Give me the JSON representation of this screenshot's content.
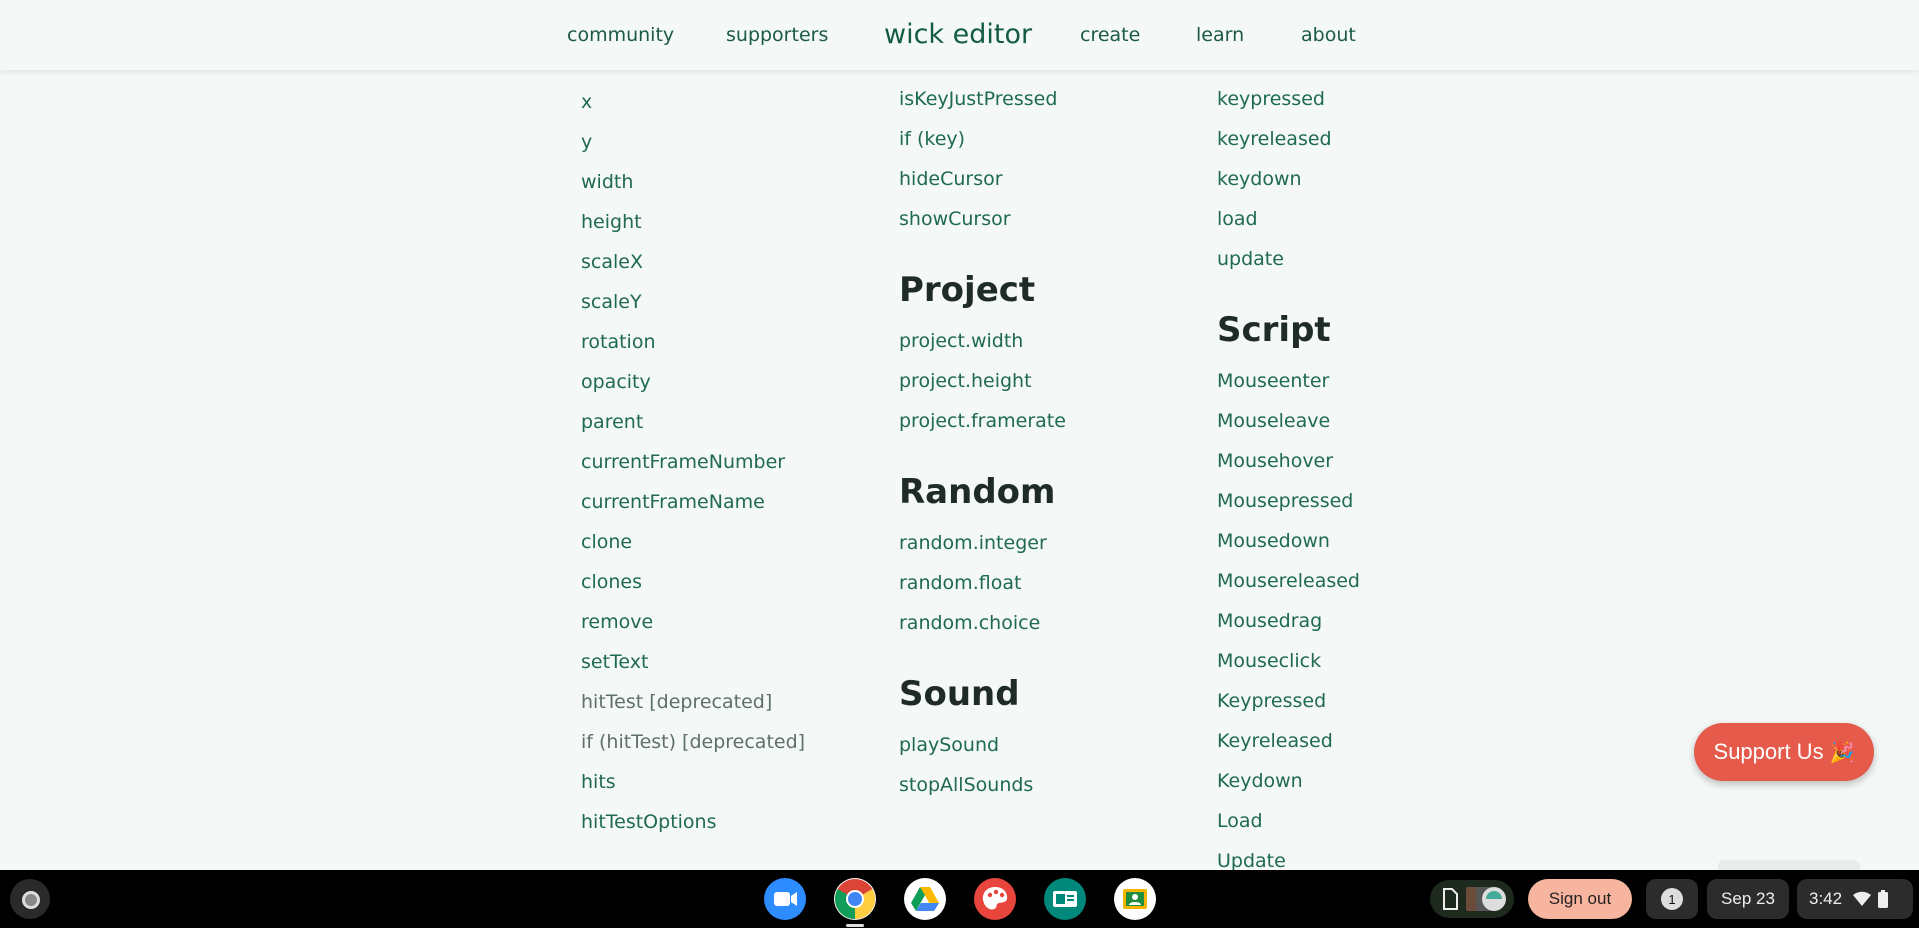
{
  "nav": {
    "community": "community",
    "supporters": "supporters",
    "brand": "wick editor",
    "create": "create",
    "learn": "learn",
    "about": "about"
  },
  "col1": {
    "items": [
      "x",
      "y",
      "width",
      "height",
      "scaleX",
      "scaleY",
      "rotation",
      "opacity",
      "parent",
      "currentFrameNumber",
      "currentFrameName",
      "clone",
      "clones",
      "remove",
      "setText",
      "hitTest [deprecated]",
      "if (hitTest) [deprecated]",
      "hits",
      "hitTestOptions"
    ]
  },
  "col2": {
    "input_items": [
      "isKeyJustPressed",
      "if (key)",
      "hideCursor",
      "showCursor"
    ],
    "project": {
      "title": "Project",
      "items": [
        "project.width",
        "project.height",
        "project.framerate"
      ]
    },
    "random": {
      "title": "Random",
      "items": [
        "random.integer",
        "random.float",
        "random.choice"
      ]
    },
    "sound": {
      "title": "Sound",
      "items": [
        "playSound",
        "stopAllSounds"
      ]
    }
  },
  "col3": {
    "event_items": [
      "keypressed",
      "keyreleased",
      "keydown",
      "load",
      "update"
    ],
    "script": {
      "title": "Script",
      "items": [
        "Mouseenter",
        "Mouseleave",
        "Mousehover",
        "Mousepressed",
        "Mousedown",
        "Mousereleased",
        "Mousedrag",
        "Mouseclick",
        "Keypressed",
        "Keyreleased",
        "Keydown",
        "Load",
        "Update"
      ]
    }
  },
  "support": {
    "label": "Support Us",
    "emoji": "🎉"
  },
  "taskbar": {
    "signout": "Sign out",
    "notifications": "1",
    "date": "Sep 23",
    "time": "3:42",
    "colors": {
      "zoom": "#2d8cff",
      "drive_yellow": "#ffba00",
      "canvas_red": "#e8453c",
      "meet_teal": "#00897b",
      "classroom": "#1e8e3e"
    }
  }
}
